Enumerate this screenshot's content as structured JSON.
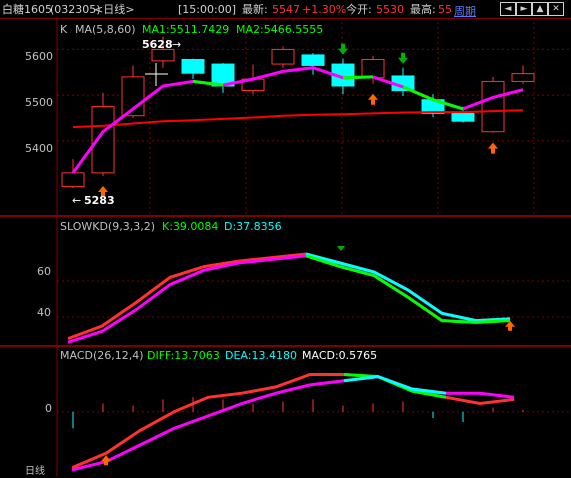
{
  "header": {
    "symbol": "白糖1605",
    "code": "(032305)",
    "period_text": "<日线>",
    "time_label": "[15:00:00]",
    "latest_label": "最新:",
    "latest_value": "5547",
    "change": "+1.30%",
    "open_label": "今开:",
    "open_value": "5530",
    "high_label": "最高:",
    "high_value": "55",
    "period_link": "周期",
    "nav_icons": [
      "arrow-left-icon",
      "arrow-right-icon",
      "arrow-up-icon",
      "arrow-down-icon",
      "restore-icon",
      "close-icon"
    ]
  },
  "colors": {
    "up": "#ff3232",
    "down": "#00ffff",
    "ma1": "#ff00ff",
    "ma2": "#ff0000",
    "signal_green": "#00ff00",
    "k_line": "#00ffff",
    "grid": "#800000",
    "axis_text": "#c0c0c0",
    "buy_arrow": "#ff6600",
    "sell_arrow": "#00b000"
  },
  "main_panel": {
    "label_k": "K",
    "ma_title": "MA(5,8,60)",
    "ma1_text": "MA1:5511.7429",
    "ma2_text": "MA2:5466.5555",
    "max_label": "5628",
    "min_label": "5283",
    "y_ticks": [
      "5600",
      "5500",
      "5400"
    ]
  },
  "kd_panel": {
    "title": "SLOWKD(9,3,3,2)",
    "k_text": "K:39.0084",
    "d_text": "D:37.8356",
    "y_ticks": [
      "60",
      "40"
    ]
  },
  "macd_panel": {
    "title": "MACD(26,12,4)",
    "diff_text": "DIFF:13.7063",
    "dea_text": "DEA:13.4180",
    "macd_text": "MACD:0.5765",
    "y_ticks": [
      "0"
    ],
    "corner_text": "日线"
  },
  "chart_data": [
    {
      "type": "candlestick",
      "title": "K MA(5,8,60)",
      "ylim": [
        5240,
        5660
      ],
      "candles": [
        {
          "open": 5300,
          "close": 5330,
          "high": 5360,
          "low": 5297
        },
        {
          "open": 5330,
          "close": 5475,
          "high": 5505,
          "low": 5323
        },
        {
          "open": 5455,
          "close": 5540,
          "high": 5565,
          "low": 5450
        },
        {
          "open": 5575,
          "close": 5600,
          "high": 5628,
          "low": 5560
        },
        {
          "open": 5578,
          "close": 5548,
          "high": 5580,
          "low": 5535
        },
        {
          "open": 5568,
          "close": 5520,
          "high": 5570,
          "low": 5505
        },
        {
          "open": 5510,
          "close": 5535,
          "high": 5567,
          "low": 5502
        },
        {
          "open": 5568,
          "close": 5600,
          "high": 5606,
          "low": 5560
        },
        {
          "open": 5588,
          "close": 5565,
          "high": 5592,
          "low": 5545
        },
        {
          "open": 5568,
          "close": 5520,
          "high": 5580,
          "low": 5502
        },
        {
          "open": 5538,
          "close": 5578,
          "high": 5586,
          "low": 5525
        },
        {
          "open": 5542,
          "close": 5510,
          "high": 5560,
          "low": 5498
        },
        {
          "open": 5490,
          "close": 5460,
          "high": 5502,
          "low": 5452
        },
        {
          "open": 5460,
          "close": 5443,
          "high": 5475,
          "low": 5440
        },
        {
          "open": 5420,
          "close": 5530,
          "high": 5540,
          "low": 5418
        },
        {
          "open": 5530,
          "close": 5547,
          "high": 5565,
          "low": 5525
        }
      ],
      "ma1": [
        5330,
        5420,
        5470,
        5520,
        5530,
        5522,
        5535,
        5552,
        5560,
        5538,
        5540,
        5518,
        5490,
        5470,
        5495,
        5512
      ],
      "ma2": [
        5430,
        5433,
        5438,
        5443,
        5445,
        5448,
        5451,
        5455,
        5457,
        5458,
        5460,
        5462,
        5463,
        5463,
        5465,
        5467
      ],
      "buy_signals": [
        1,
        10,
        14
      ],
      "sell_signals": [
        9,
        11
      ]
    },
    {
      "type": "line",
      "title": "SLOWKD(9,3,3,2)",
      "ylim": [
        25,
        85
      ],
      "x": [
        0,
        1,
        2,
        3,
        4,
        5,
        6,
        7,
        8,
        9,
        10,
        11,
        12,
        13,
        14,
        15
      ],
      "series": [
        {
          "name": "K",
          "values": [
            28,
            35,
            48,
            62,
            68,
            71,
            73,
            75,
            70,
            65,
            55,
            42,
            38,
            39
          ]
        },
        {
          "name": "D",
          "values": [
            26,
            32,
            44,
            58,
            66,
            70,
            72,
            74,
            68,
            63,
            51,
            38,
            37,
            38
          ]
        }
      ],
      "sell_signals": [
        8
      ],
      "buy_signals": [
        13
      ]
    },
    {
      "type": "line",
      "title": "MACD(26,12,4)",
      "ylim": [
        -30,
        25
      ],
      "series": [
        {
          "name": "DIFF",
          "values": [
            -27,
            -20,
            -9,
            0,
            7,
            9,
            12,
            18,
            18,
            17,
            10,
            7,
            4,
            6
          ]
        },
        {
          "name": "DEA",
          "values": [
            -28,
            -24,
            -16,
            -8,
            -2,
            4,
            9,
            13,
            15,
            17,
            11,
            9,
            9,
            7
          ]
        }
      ],
      "macd_bars": [
        -8,
        4,
        3,
        6,
        7,
        6,
        4,
        5,
        6,
        3,
        4,
        5,
        -3,
        -5,
        2,
        1
      ],
      "buy_signals": [
        1
      ],
      "sell_signals": []
    }
  ]
}
